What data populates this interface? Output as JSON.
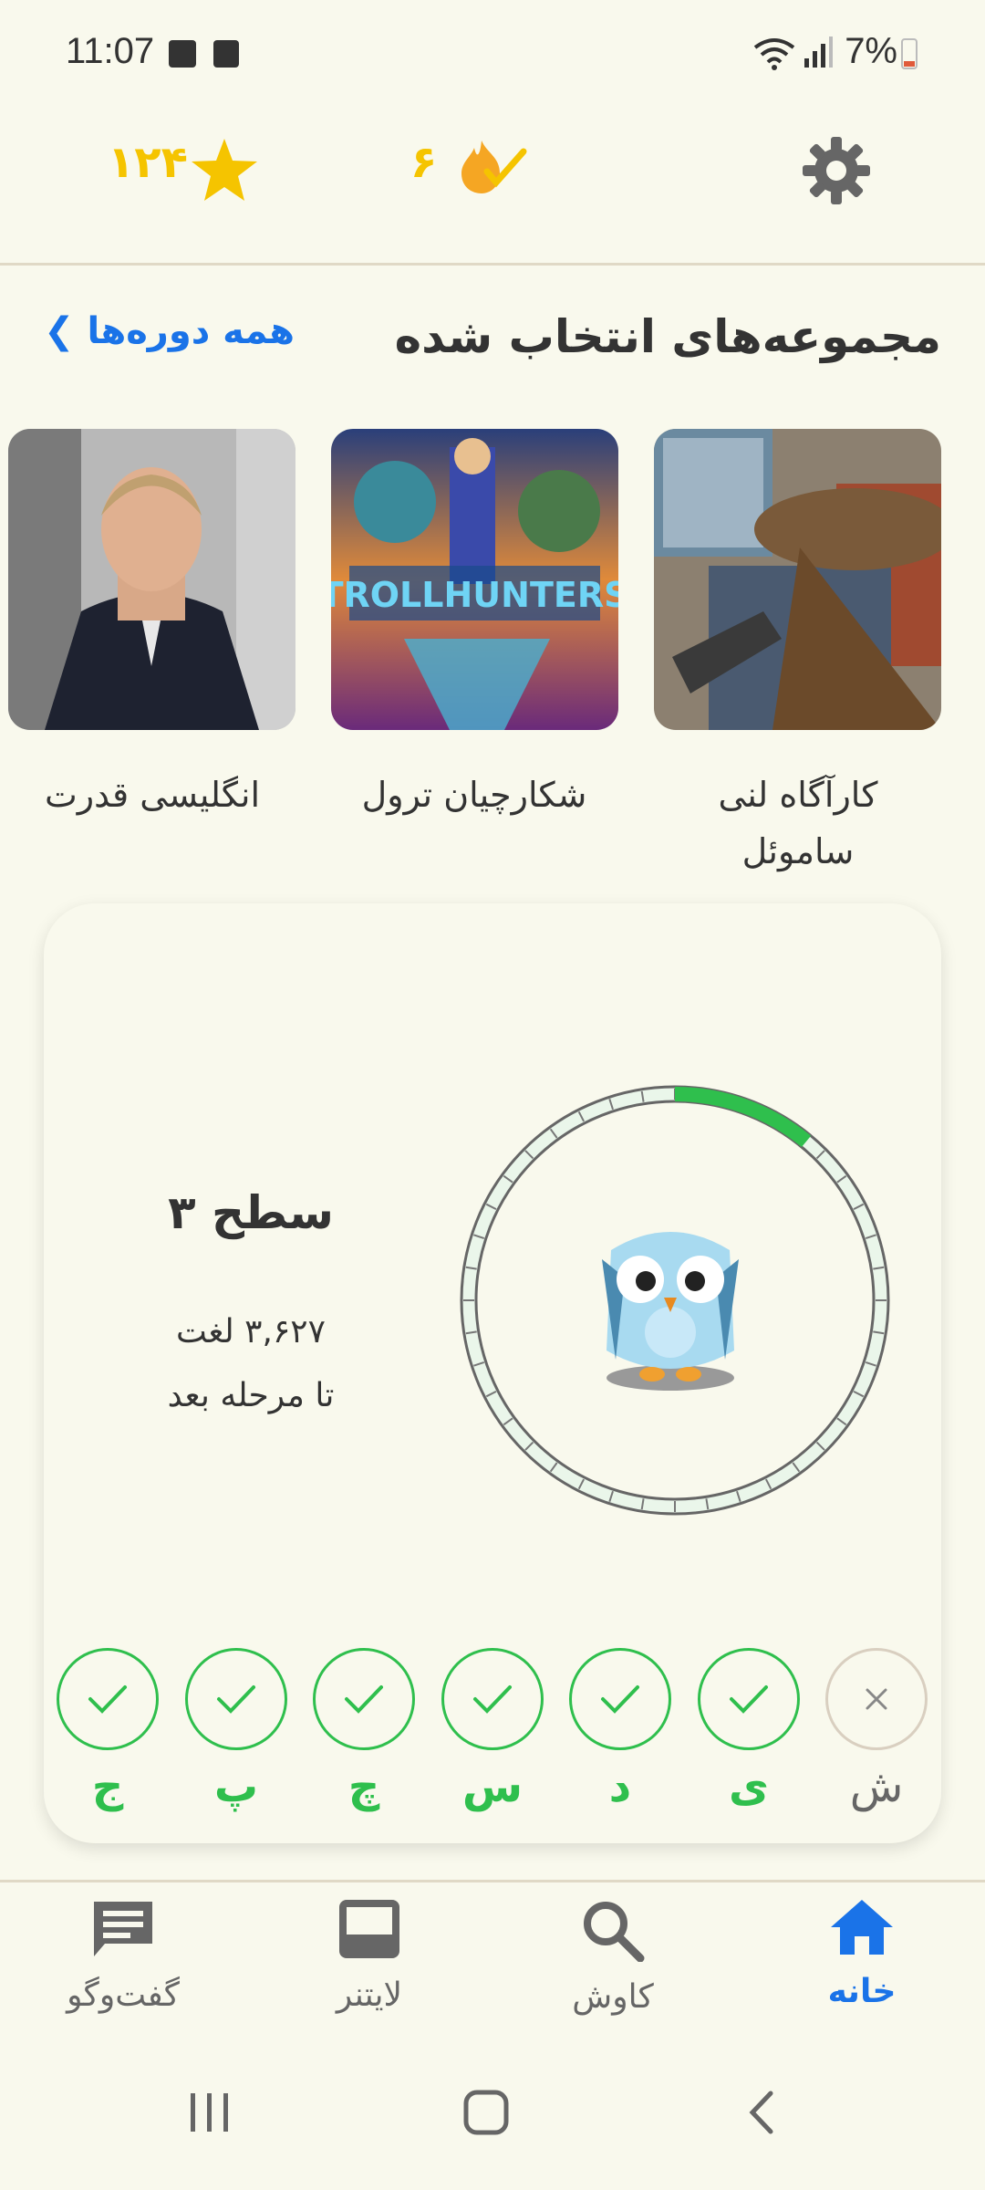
{
  "status": {
    "time": "11:07",
    "battery": "7%"
  },
  "header": {
    "stars": "۱۲۴",
    "streak": "۶",
    "icons": {
      "star": "star-icon",
      "streak": "flame-check-icon",
      "settings": "gear-icon"
    },
    "accent": "#f5c400"
  },
  "section": {
    "title": "مجموعه‌های انتخاب شده",
    "all_link": "همه دوره‌ها ❯"
  },
  "collections": [
    {
      "title": "کارآگاه لنی",
      "title2": "ساموئل"
    },
    {
      "title": "شکارچیان ترول"
    },
    {
      "title": "انگلیسی قدرت"
    }
  ],
  "level": {
    "title": "سطح ۳",
    "words": "۳,۶۲۷ لغت",
    "next": "تا مرحله بعد",
    "progress": 0.11
  },
  "week": {
    "days": [
      {
        "label": "ش",
        "done": false
      },
      {
        "label": "ی",
        "done": true
      },
      {
        "label": "د",
        "done": true
      },
      {
        "label": "س",
        "done": true
      },
      {
        "label": "چ",
        "done": true
      },
      {
        "label": "پ",
        "done": true
      },
      {
        "label": "ج",
        "done": true
      }
    ],
    "done_color": "#2fbf4d"
  },
  "nav": [
    {
      "label": "خانه",
      "icon": "home-icon",
      "active": true
    },
    {
      "label": "کاوش",
      "icon": "search-icon",
      "active": false
    },
    {
      "label": "لایتنر",
      "icon": "inbox-icon",
      "active": false
    },
    {
      "label": "گفت‌وگو",
      "icon": "chat-icon",
      "active": false
    }
  ]
}
